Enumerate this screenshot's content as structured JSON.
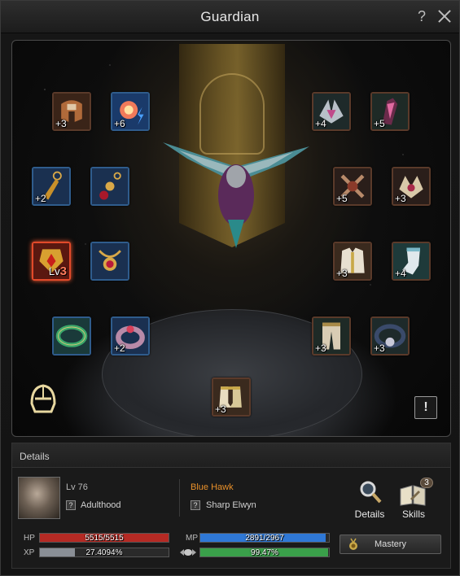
{
  "window": {
    "title": "Guardian",
    "help_label": "?"
  },
  "slots": [
    {
      "id": "slot-1",
      "enh": "+3"
    },
    {
      "id": "slot-2",
      "enh": "+6"
    },
    {
      "id": "slot-3",
      "enh": "+4"
    },
    {
      "id": "slot-4",
      "enh": "+5"
    },
    {
      "id": "slot-5",
      "enh": "+2"
    },
    {
      "id": "slot-6",
      "enh": ""
    },
    {
      "id": "slot-7",
      "enh": "+5"
    },
    {
      "id": "slot-8",
      "enh": "+3"
    },
    {
      "id": "slot-9",
      "enh": "",
      "level_prefix": "Lv",
      "level_value": "3"
    },
    {
      "id": "slot-10",
      "enh": ""
    },
    {
      "id": "slot-11",
      "enh": "+3"
    },
    {
      "id": "slot-12",
      "enh": "+4"
    },
    {
      "id": "slot-13",
      "enh": ""
    },
    {
      "id": "slot-14",
      "enh": "+2"
    },
    {
      "id": "slot-15",
      "enh": "+3"
    },
    {
      "id": "slot-16",
      "enh": "+3"
    },
    {
      "id": "slot-17",
      "enh": "+3"
    }
  ],
  "warning_label": "!",
  "details": {
    "title": "Details",
    "level": "Lv 76",
    "question_mark": "?",
    "stage": "Adulthood",
    "name": "Blue Hawk",
    "race": "Sharp Elwyn",
    "details_button": "Details",
    "skills_button": "Skills",
    "skills_count": "3"
  },
  "stats": {
    "hp_label": "HP",
    "hp_value": "5515/5515",
    "hp_fraction": 1.0,
    "mp_label": "MP",
    "mp_value": "2891/2967",
    "mp_fraction": 0.974,
    "xp_label": "XP",
    "xp_value": "27.4094%",
    "xp_fraction": 0.274,
    "food_value": "99.47%",
    "food_fraction": 0.9947,
    "mastery_label": "Mastery"
  },
  "colors": {
    "hp": "#b52a24",
    "mp": "#2f78d6",
    "xp": "#8a8f96",
    "food": "#3aa04a",
    "accent_name": "#e8902a"
  }
}
